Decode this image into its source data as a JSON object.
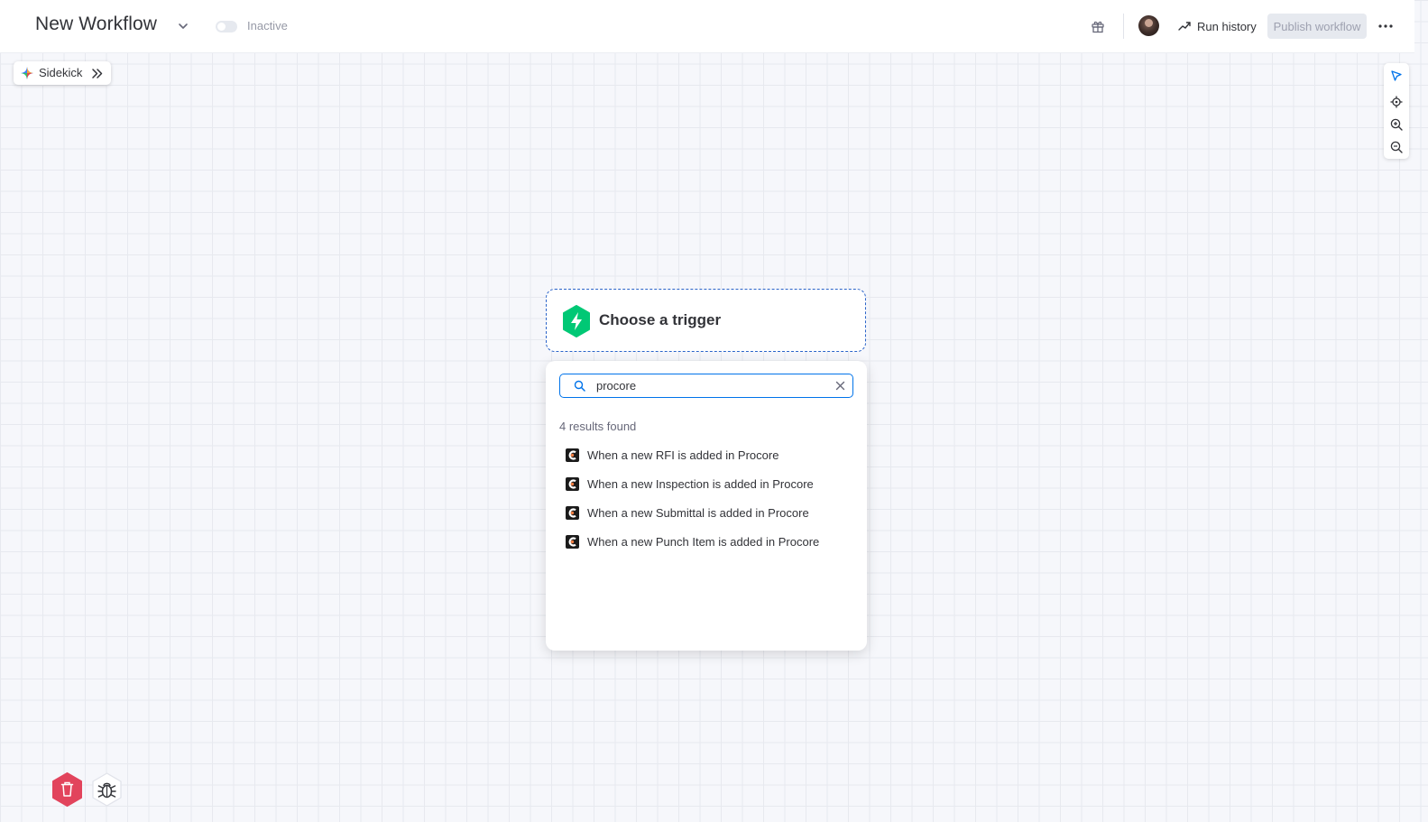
{
  "header": {
    "workflow_title": "New Workflow",
    "status_label": "Inactive",
    "run_history_label": "Run history",
    "publish_label": "Publish workflow"
  },
  "sidekick": {
    "label": "Sidekick"
  },
  "trigger": {
    "title": "Choose a trigger"
  },
  "search": {
    "value": "procore",
    "results_count_label": "4 results found",
    "results": [
      {
        "label": "When a new RFI is added in Procore"
      },
      {
        "label": "When a new Inspection is added in Procore"
      },
      {
        "label": "When a new Submittal is added in Procore"
      },
      {
        "label": "When a new Punch Item is added in Procore"
      }
    ]
  },
  "icons": {
    "title_dropdown": "chevron-down-icon",
    "gift": "gift-icon",
    "run_history": "trend-icon",
    "more": "more-horizontal-icon",
    "sidekick": "sparkle-icon",
    "sidekick_expand": "double-chevron-right-icon",
    "select_tool": "pointer-icon",
    "center_tool": "crosshair-icon",
    "zoom_in": "zoom-in-icon",
    "zoom_out": "zoom-out-icon",
    "trigger": "lightning-icon",
    "search": "search-icon",
    "clear": "close-icon",
    "result": "procore-logo-icon",
    "delete": "trash-icon",
    "debug": "bug-icon"
  },
  "colors": {
    "accent": "#0073ea",
    "trigger_green": "#00c875",
    "delete_red": "#e2445c",
    "dashed_border": "#2b64c9",
    "procore_orange": "#f47e42"
  }
}
